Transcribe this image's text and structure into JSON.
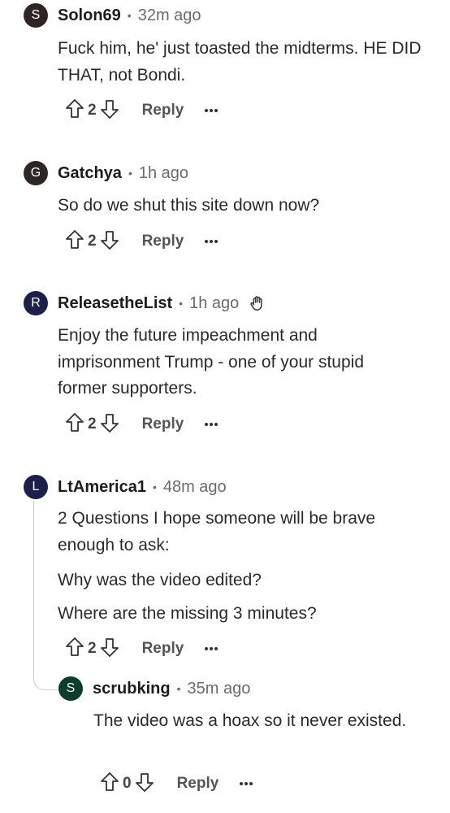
{
  "comments": [
    {
      "user": "Solon69",
      "avatar_letter": "S",
      "avatar_color": "#2d2524",
      "time": "32m ago",
      "lines": [
        "Fuck him, he' just toasted the midterms. HE DID THAT, not Bondi."
      ],
      "votes": "2",
      "reply_label": "Reply"
    },
    {
      "user": "Gatchya",
      "avatar_letter": "G",
      "avatar_color": "#2d2524",
      "time": "1h ago",
      "lines": [
        "So do we shut this site down now?"
      ],
      "votes": "2",
      "reply_label": "Reply"
    },
    {
      "user": "ReleasetheList",
      "avatar_letter": "R",
      "avatar_color": "#1c1f4a",
      "time": "1h ago",
      "lines": [
        "Enjoy the future impeachment and imprisonment Trump - one of your stupid former supporters."
      ],
      "votes": "2",
      "reply_label": "Reply"
    },
    {
      "user": "LtAmerica1",
      "avatar_letter": "L",
      "avatar_color": "#1c1f4a",
      "time": "48m ago",
      "lines": [
        "2 Questions I hope someone will be brave enough to ask:",
        "Why was the video edited?",
        "Where are the missing 3 minutes?"
      ],
      "votes": "2",
      "reply_label": "Reply"
    },
    {
      "user": "scrubking",
      "avatar_letter": "S",
      "avatar_color": "#0e3d2e",
      "time": "35m ago",
      "lines": [
        "The video was a hoax so it never existed."
      ],
      "votes": "0",
      "reply_label": "Reply"
    }
  ]
}
